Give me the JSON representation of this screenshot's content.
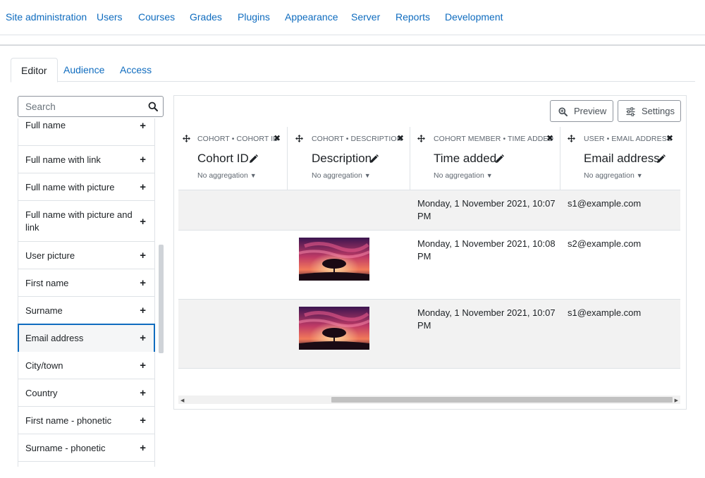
{
  "topnav": {
    "items": [
      "Site administration",
      "Users",
      "Courses",
      "Grades",
      "Plugins",
      "Appearance",
      "Server",
      "Reports",
      "Development"
    ]
  },
  "tabs": [
    {
      "label": "Editor",
      "active": true
    },
    {
      "label": "Audience",
      "active": false
    },
    {
      "label": "Access",
      "active": false
    }
  ],
  "sidebar": {
    "search_placeholder": "Search",
    "items": [
      {
        "label": "Full name"
      },
      {
        "label": "Full name with link"
      },
      {
        "label": "Full name with picture"
      },
      {
        "label": "Full name with picture and link"
      },
      {
        "label": "User picture"
      },
      {
        "label": "First name"
      },
      {
        "label": "Surname"
      },
      {
        "label": "Email address",
        "selected": true
      },
      {
        "label": "City/town"
      },
      {
        "label": "Country"
      },
      {
        "label": "First name - phonetic"
      },
      {
        "label": "Surname - phonetic"
      }
    ],
    "add_glyph": "+"
  },
  "toolbar": {
    "preview_label": "Preview",
    "settings_label": "Settings"
  },
  "columns": [
    {
      "caption": "COHORT • COHORT ID",
      "name": "Cohort ID",
      "aggregation": "No aggregation"
    },
    {
      "caption": "COHORT • DESCRIPTION",
      "name": "Description",
      "aggregation": "No aggregation"
    },
    {
      "caption": "COHORT MEMBER • TIME ADDED",
      "name": "Time added",
      "aggregation": "No aggregation"
    },
    {
      "caption": "USER • EMAIL ADDRESS",
      "name": "Email address",
      "aggregation": "No aggregation"
    }
  ],
  "rows": [
    {
      "cohort_id": "",
      "has_image": false,
      "time_added_line1": "Monday, 1 November 2021, 10:07",
      "time_added_line2": "PM",
      "email": "s1@example.com"
    },
    {
      "cohort_id": "",
      "has_image": true,
      "time_added_line1": "Monday, 1 November 2021, 10:08",
      "time_added_line2": "PM",
      "email": "s2@example.com"
    },
    {
      "cohort_id": "",
      "has_image": true,
      "time_added_line1": "Monday, 1 November 2021, 10:07",
      "time_added_line2": "PM",
      "email": "s1@example.com"
    }
  ],
  "colors": {
    "link": "#0f6cbf",
    "border": "#dee2e6",
    "selected_border": "#0f6cbf",
    "row_alt": "#f2f2f2"
  }
}
